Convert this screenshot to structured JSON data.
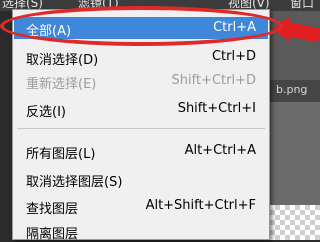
{
  "menubar": {
    "items": [
      {
        "label": "选择(S)"
      },
      {
        "label": "滤镜(T)"
      },
      {
        "label": "视图(V)"
      },
      {
        "label": "窗口"
      }
    ]
  },
  "document_tab": {
    "label": "b.png"
  },
  "select_menu": {
    "items": [
      {
        "label": "全部(A)",
        "shortcut": "Ctrl+A"
      },
      {
        "label": "取消选择(D)",
        "shortcut": "Ctrl+D"
      },
      {
        "label": "重新选择(E)",
        "shortcut": "Shift+Ctrl+D"
      },
      {
        "label": "反选(I)",
        "shortcut": "Shift+Ctrl+I"
      },
      {
        "label": "所有图层(L)",
        "shortcut": "Alt+Ctrl+A"
      },
      {
        "label": "取消选择图层(S)",
        "shortcut": ""
      },
      {
        "label": "查找图层",
        "shortcut": "Alt+Shift+Ctrl+F"
      },
      {
        "label": "隔离图层",
        "shortcut": ""
      }
    ]
  },
  "colors": {
    "highlight": "#3f87d8",
    "annotation": "#e02a2a",
    "menu_background": "#f0f0f0",
    "disabled_text": "#9c9c9c"
  }
}
